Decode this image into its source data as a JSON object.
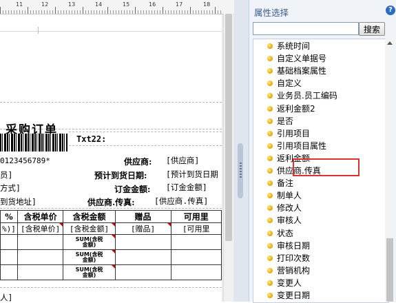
{
  "ruler": {
    "ticks": [
      "11",
      "12",
      "13",
      "14",
      "15",
      "16",
      "17",
      "18"
    ]
  },
  "report": {
    "title": "采购订单",
    "txt22_label": "Txt22:",
    "barcode_text": "0123456789*",
    "supplier_label": "供应商:",
    "supplier_value": "[供应商]",
    "row2_left": "员]",
    "expected_date_label": "预计到货日期:",
    "expected_date_value": "[预计到货日期",
    "row3_left": "方式]",
    "order_amount_label": "订金金额:",
    "order_amount_value": "[订金金额]",
    "row4_left": "到货地址]",
    "supplier_fax_label": "供应商.传真:",
    "supplier_fax_value": "[供应商.传真]",
    "table": {
      "headers": [
        "%",
        "含税单价",
        "含税金额",
        "赠品",
        "可用里"
      ],
      "fields": [
        "%)]",
        "[含税单价]",
        "[含税金额]",
        "[赠品]",
        "[可用里"
      ],
      "sum_line1": "SUM(含税",
      "sum_line2": "金额)"
    },
    "footer_left": "人]"
  },
  "panel": {
    "title": "属性选择",
    "help_icon": "?",
    "search_placeholder": "",
    "search_button": "搜索",
    "items": [
      "系统时间",
      "自定义单据号",
      "基础档案属性",
      "自定义",
      "业务员.员工编码",
      "返利金额2",
      "是否",
      "引用项目",
      "引用项目属性",
      "返利金额",
      "供应商.传真",
      "备注",
      "制单人",
      "修改人",
      "审核人",
      "状态",
      "审核日期",
      "打印次数",
      "营销机构",
      "变更人",
      "变更日期"
    ],
    "highlighted_item": "供应商.传真"
  },
  "colors": {
    "highlight_border": "#d8312f",
    "panel_title": "#3a5a8c",
    "bullet": "#e0a800"
  }
}
